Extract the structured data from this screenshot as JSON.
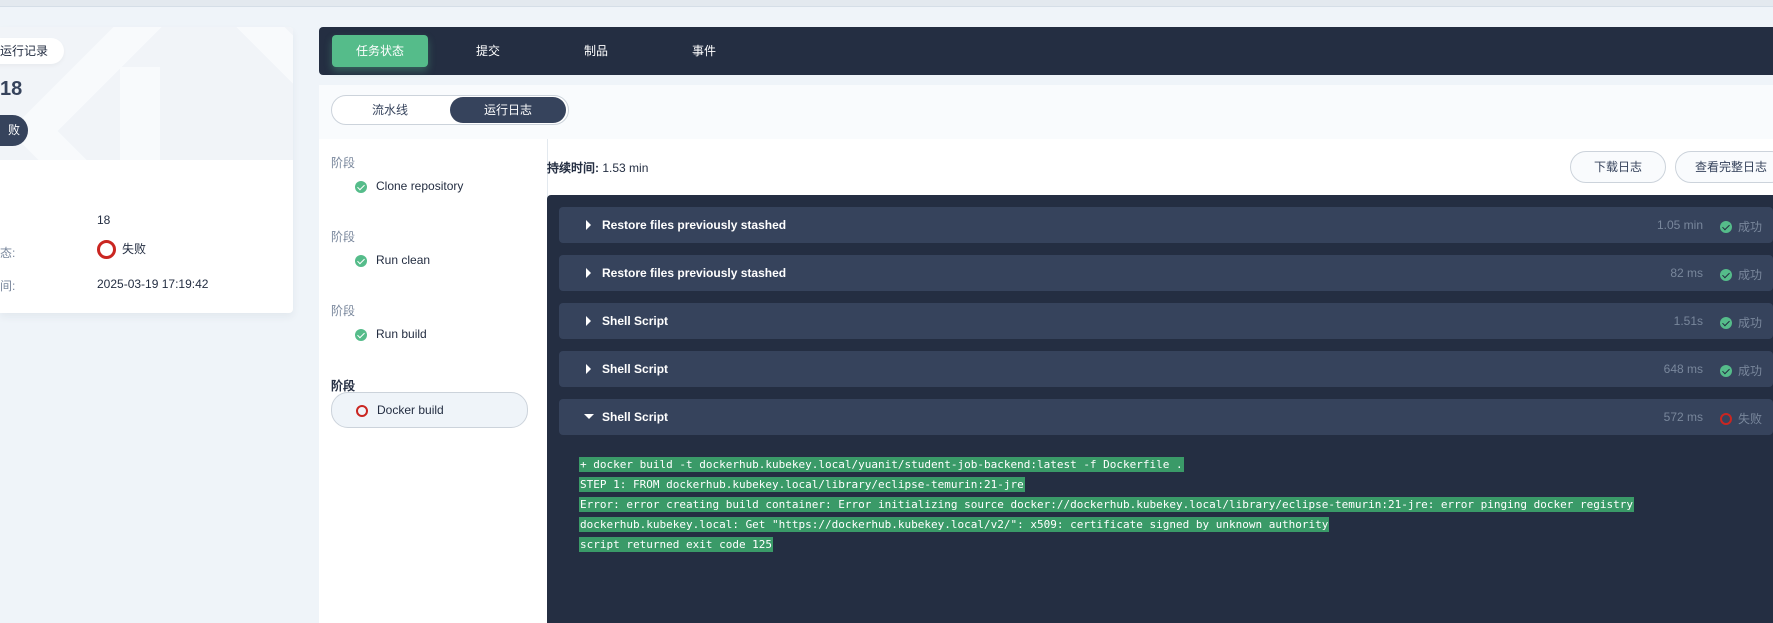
{
  "left": {
    "back_label": "运行记录",
    "run_number": "18",
    "status_pill": "败",
    "fields": [
      {
        "label": "",
        "value": "18"
      },
      {
        "label": "态:",
        "value": "失败"
      },
      {
        "label": "间:",
        "value": "2025-03-19 17:19:42"
      }
    ]
  },
  "tabs": [
    "任务状态",
    "提交",
    "制品",
    "事件"
  ],
  "subtabs": [
    "流水线",
    "运行日志"
  ],
  "stages": [
    {
      "heading": "阶段",
      "step": "Clone repository",
      "status": "success"
    },
    {
      "heading": "阶段",
      "step": "Run clean",
      "status": "success"
    },
    {
      "heading": "阶段",
      "step": "Run build",
      "status": "success"
    },
    {
      "heading": "阶段",
      "step": "Docker build",
      "status": "failed"
    }
  ],
  "log": {
    "duration_label": "持续时间:",
    "duration_value": "1.53 min",
    "download_button": "下载日志",
    "full_log_button": "查看完整日志",
    "steps": [
      {
        "title": "Restore files previously stashed",
        "time": "1.05 min",
        "result": "成功"
      },
      {
        "title": "Restore files previously stashed",
        "time": "82 ms",
        "result": "成功"
      },
      {
        "title": "Shell Script",
        "time": "1.51s",
        "result": "成功"
      },
      {
        "title": "Shell Script",
        "time": "648 ms",
        "result": "成功"
      },
      {
        "title": "Shell Script",
        "time": "572 ms",
        "result": "失败"
      }
    ],
    "output": [
      "+ docker build -t dockerhub.kubekey.local/yuanit/student-job-backend:latest -f Dockerfile .",
      "STEP 1: FROM dockerhub.kubekey.local/library/eclipse-temurin:21-jre",
      "Error: error creating build container: Error initializing source docker://dockerhub.kubekey.local/library/eclipse-temurin:21-jre: error pinging docker registry",
      "dockerhub.kubekey.local: Get \"https://dockerhub.kubekey.local/v2/\": x509: certificate signed by unknown authority",
      "script returned exit code 125"
    ]
  },
  "colors": {
    "accent": "#55bc8a",
    "dark": "#242e42",
    "fail": "#ca2621"
  }
}
